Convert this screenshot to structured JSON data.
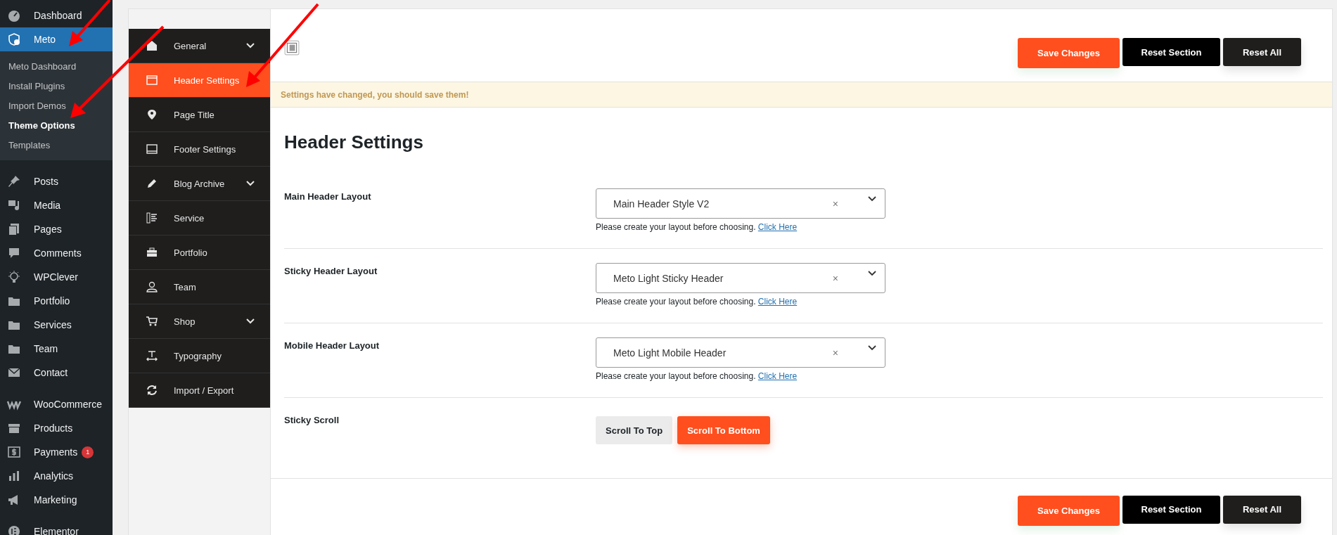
{
  "admin_menu": {
    "groups": [
      [
        {
          "label": "Dashboard",
          "selected": false
        },
        {
          "label": "Meto",
          "selected": true,
          "children": [
            {
              "label": "Meto Dashboard",
              "selected": false
            },
            {
              "label": "Install Plugins",
              "selected": false
            },
            {
              "label": "Import Demos",
              "selected": false
            },
            {
              "label": "Theme Options",
              "selected": true
            },
            {
              "label": "Templates",
              "selected": false
            }
          ]
        },
        {
          "label": "Posts",
          "selected": false
        },
        {
          "label": "Media",
          "selected": false
        },
        {
          "label": "Pages",
          "selected": false
        },
        {
          "label": "Comments",
          "selected": false
        },
        {
          "label": "WPClever",
          "selected": false
        },
        {
          "label": "Portfolio",
          "selected": false
        },
        {
          "label": "Services",
          "selected": false
        },
        {
          "label": "Team",
          "selected": false
        },
        {
          "label": "Contact",
          "selected": false
        }
      ],
      [
        {
          "label": "WooCommerce",
          "selected": false
        },
        {
          "label": "Products",
          "selected": false
        },
        {
          "label": "Payments",
          "selected": false,
          "badge": "1"
        },
        {
          "label": "Analytics",
          "selected": false
        },
        {
          "label": "Marketing",
          "selected": false
        }
      ],
      [
        {
          "label": "Elementor",
          "selected": false
        }
      ]
    ]
  },
  "options_nav": {
    "items": [
      {
        "label": "General",
        "selected": false,
        "expandable": true
      },
      {
        "label": "Header Settings",
        "selected": true,
        "expandable": false
      },
      {
        "label": "Page Title",
        "selected": false,
        "expandable": false
      },
      {
        "label": "Footer Settings",
        "selected": false,
        "expandable": false
      },
      {
        "label": "Blog Archive",
        "selected": false,
        "expandable": true
      },
      {
        "label": "Service",
        "selected": false,
        "expandable": false
      },
      {
        "label": "Portfolio",
        "selected": false,
        "expandable": false
      },
      {
        "label": "Team",
        "selected": false,
        "expandable": false
      },
      {
        "label": "Shop",
        "selected": false,
        "expandable": true
      },
      {
        "label": "Typography",
        "selected": false,
        "expandable": false
      },
      {
        "label": "Import / Export",
        "selected": false,
        "expandable": false
      }
    ]
  },
  "top_actions": [
    {
      "label": "Save Changes",
      "kind": "save"
    },
    {
      "label": "Reset Section",
      "kind": "reset-section"
    },
    {
      "label": "Reset All",
      "kind": "reset-all"
    }
  ],
  "notice": "Settings have changed, you should save them!",
  "section": {
    "title": "Header Settings",
    "fields": [
      {
        "kind": "select",
        "label": "Main Header Layout",
        "value": "Main Header Style V2",
        "clear": "×",
        "help": "Please create your layout before choosing.",
        "link": "Click Here"
      },
      {
        "kind": "select",
        "label": "Sticky Header Layout",
        "value": "Meto Light Sticky Header",
        "clear": "×",
        "help": "Please create your layout before choosing.",
        "link": "Click Here"
      },
      {
        "kind": "select",
        "label": "Mobile Header Layout",
        "value": "Meto Light Mobile Header",
        "clear": "×",
        "help": "Please create your layout before choosing.",
        "link": "Click Here"
      },
      {
        "kind": "buttons",
        "label": "Sticky Scroll",
        "options": [
          {
            "label": "Scroll To Top",
            "selected": false
          },
          {
            "label": "Scroll To Bottom",
            "selected": true
          }
        ]
      }
    ]
  },
  "bottom_actions": [
    {
      "label": "Save Changes",
      "kind": "save"
    },
    {
      "label": "Reset Section",
      "kind": "reset-section"
    },
    {
      "label": "Reset All",
      "kind": "reset-all"
    }
  ]
}
